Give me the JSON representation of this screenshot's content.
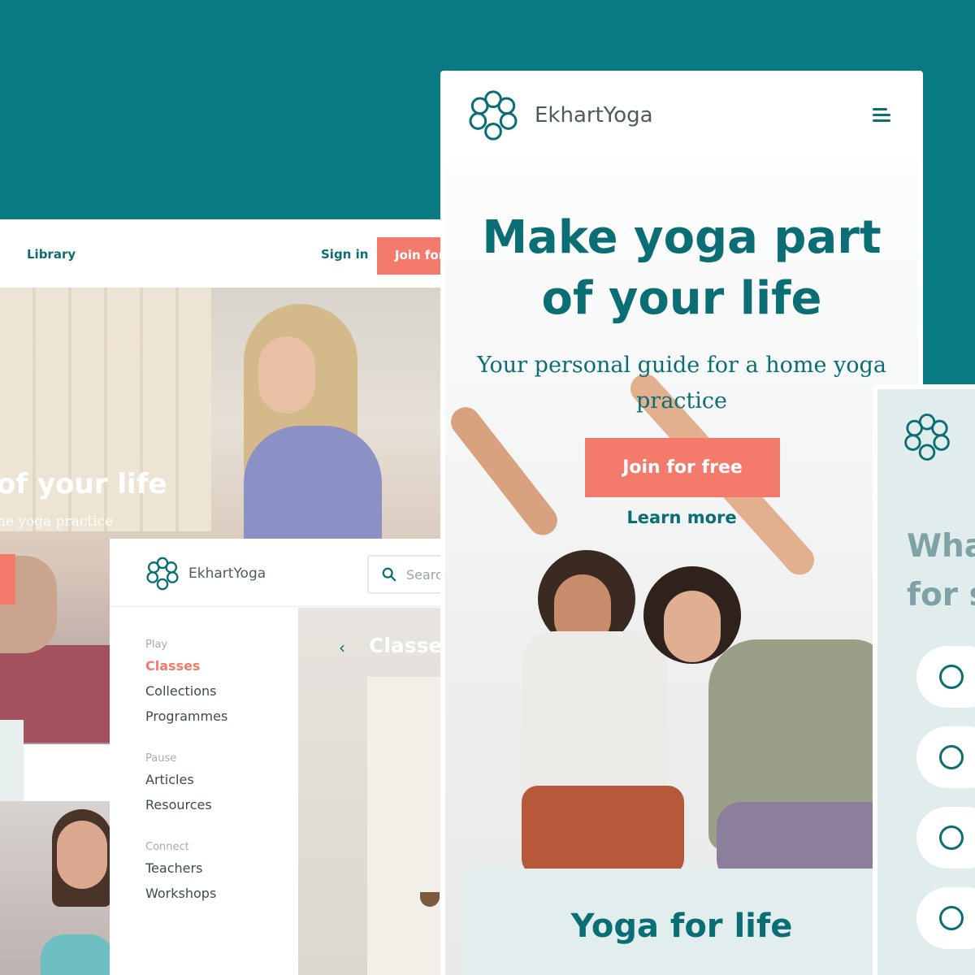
{
  "desktop": {
    "nav": {
      "library": "Library",
      "sign_in": "Sign in",
      "join": "Join for"
    },
    "hero": {
      "title": "of your life",
      "subtitle": "ne yoga practice"
    }
  },
  "classes_page": {
    "brand": "EkhartYoga",
    "search_placeholder": "Searc",
    "title": "Classes",
    "back_icon": "chevron-left-icon",
    "sections": [
      {
        "label": "Play",
        "items": [
          "Classes",
          "Collections",
          "Programmes"
        ]
      },
      {
        "label": "Pause",
        "items": [
          "Articles",
          "Resources"
        ]
      },
      {
        "label": "Connect",
        "items": [
          "Teachers",
          "Workshops"
        ]
      }
    ],
    "active_item": "Classes"
  },
  "mobile": {
    "brand": "EkhartYoga",
    "title_line1": "Make yoga part",
    "title_line2": "of your life",
    "subtitle_line1": "Your personal guide for a home yoga",
    "subtitle_line2": "practice",
    "join_label": "Join for free",
    "learn_more": "Learn more",
    "section_title": "Yoga for life"
  },
  "quiz": {
    "question_line1": "Wha",
    "question_line2": "for s",
    "option_count_visible": 4
  },
  "colors": {
    "teal": "#087a82",
    "brand": "#0b6e75",
    "coral": "#f47a6b"
  }
}
